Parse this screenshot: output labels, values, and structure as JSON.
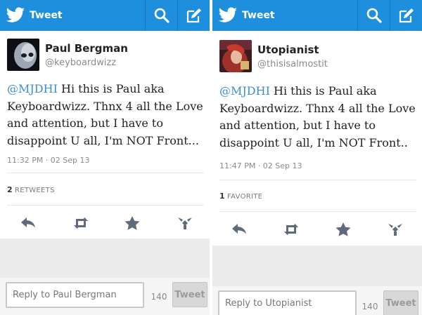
{
  "left": {
    "topbar": {
      "title": "Tweet",
      "bird_icon": "twitter-bird-icon",
      "search_icon": "search-icon",
      "compose_icon": "compose-icon",
      "color": "#1d8fdc"
    },
    "author": {
      "name": "Paul Bergman",
      "handle": "@keyboardwizz",
      "avatar": "mask-avatar"
    },
    "tweet": {
      "mention": "@MJDHI",
      "text": "  Hi this is Paul aka Keyboardwizz. Thnx 4 all the Love and attention, but I have to disappoint U all, I'm NOT Front..."
    },
    "timestamp": "11:32 PM · 02 Sep 13",
    "stat": {
      "count": "2",
      "label": "RETWEETS"
    },
    "actions": [
      "reply-icon",
      "retweet-icon",
      "favorite-icon",
      "more-icon"
    ],
    "reply": {
      "placeholder": "Reply to Paul Bergman",
      "count": "140",
      "button": "Tweet"
    }
  },
  "right": {
    "topbar": {
      "title": "Tweet",
      "bird_icon": "twitter-bird-icon",
      "search_icon": "search-icon",
      "compose_icon": "compose-icon",
      "color": "#1d8fdc"
    },
    "author": {
      "name": "Utopianist",
      "handle": "@thisisalmostit",
      "avatar": "illustrated-avatar"
    },
    "tweet": {
      "mention": "@MJDHI",
      "text": " Hi this is Paul aka Keyboardwizz. Thnx 4 all the Love and attention, but I have to disappoint U all, I'm NOT Front.."
    },
    "timestamp": "11:47 PM · 02 Sep 13",
    "stat": {
      "count": "1",
      "label": "FAVORITE"
    },
    "actions": [
      "reply-icon",
      "retweet-icon",
      "favorite-icon",
      "more-icon"
    ],
    "reply": {
      "placeholder": "Reply to Utopianist",
      "count": "140",
      "button": "Tweet"
    }
  }
}
